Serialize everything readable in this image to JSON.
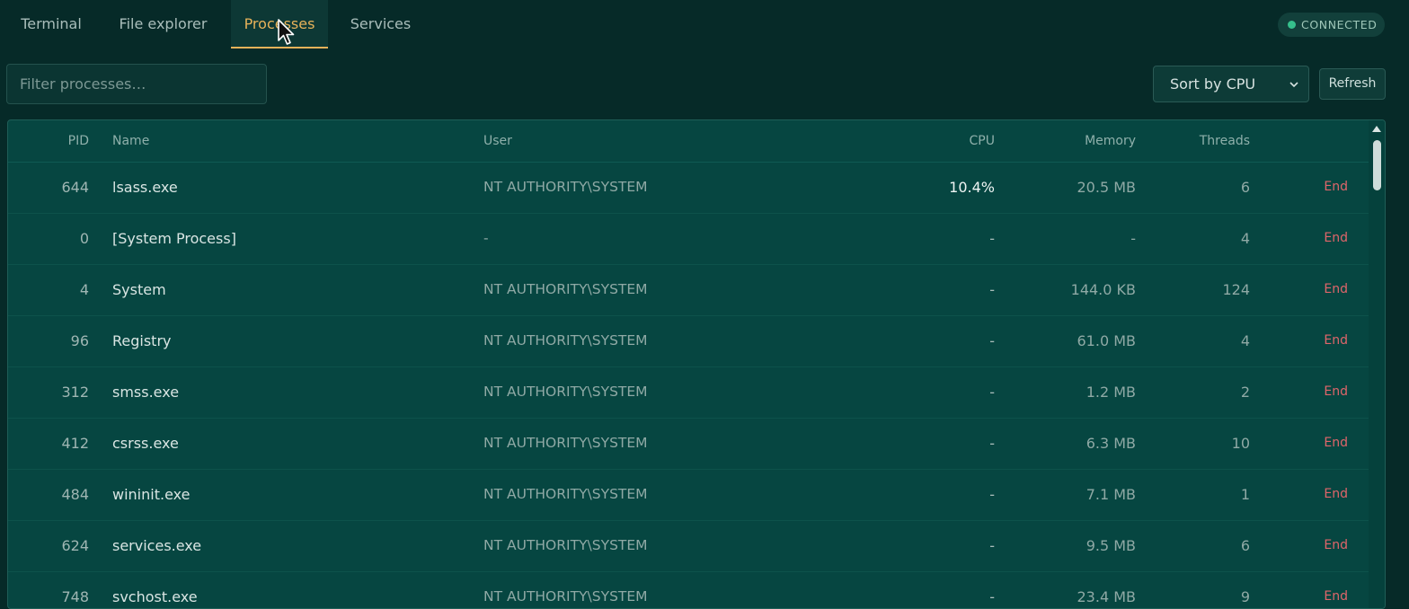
{
  "tabs": [
    {
      "label": "Terminal",
      "active": false
    },
    {
      "label": "File explorer",
      "active": false
    },
    {
      "label": "Processes",
      "active": true
    },
    {
      "label": "Services",
      "active": false
    }
  ],
  "connection_status": "CONNECTED",
  "filter": {
    "placeholder": "Filter processes…",
    "value": ""
  },
  "sort": {
    "selected": "Sort by CPU"
  },
  "refresh_label": "Refresh",
  "columns": {
    "pid": "PID",
    "name": "Name",
    "user": "User",
    "cpu": "CPU",
    "memory": "Memory",
    "threads": "Threads"
  },
  "end_label": "End",
  "processes": [
    {
      "pid": "644",
      "name": "lsass.exe",
      "user": "NT AUTHORITY\\SYSTEM",
      "cpu": "10.4%",
      "memory": "20.5 MB",
      "threads": "6"
    },
    {
      "pid": "0",
      "name": "[System Process]",
      "user": "-",
      "cpu": "-",
      "memory": "-",
      "threads": "4"
    },
    {
      "pid": "4",
      "name": "System",
      "user": "NT AUTHORITY\\SYSTEM",
      "cpu": "-",
      "memory": "144.0 KB",
      "threads": "124"
    },
    {
      "pid": "96",
      "name": "Registry",
      "user": "NT AUTHORITY\\SYSTEM",
      "cpu": "-",
      "memory": "61.0 MB",
      "threads": "4"
    },
    {
      "pid": "312",
      "name": "smss.exe",
      "user": "NT AUTHORITY\\SYSTEM",
      "cpu": "-",
      "memory": "1.2 MB",
      "threads": "2"
    },
    {
      "pid": "412",
      "name": "csrss.exe",
      "user": "NT AUTHORITY\\SYSTEM",
      "cpu": "-",
      "memory": "6.3 MB",
      "threads": "10"
    },
    {
      "pid": "484",
      "name": "wininit.exe",
      "user": "NT AUTHORITY\\SYSTEM",
      "cpu": "-",
      "memory": "7.1 MB",
      "threads": "1"
    },
    {
      "pid": "624",
      "name": "services.exe",
      "user": "NT AUTHORITY\\SYSTEM",
      "cpu": "-",
      "memory": "9.5 MB",
      "threads": "6"
    },
    {
      "pid": "748",
      "name": "svchost.exe",
      "user": "NT AUTHORITY\\SYSTEM",
      "cpu": "-",
      "memory": "23.4 MB",
      "threads": "9"
    }
  ],
  "colors": {
    "accent": "#e7b25a",
    "danger": "#e0656a",
    "status_ok": "#35c08c",
    "background": "#062a28",
    "table_bg": "#064641"
  }
}
